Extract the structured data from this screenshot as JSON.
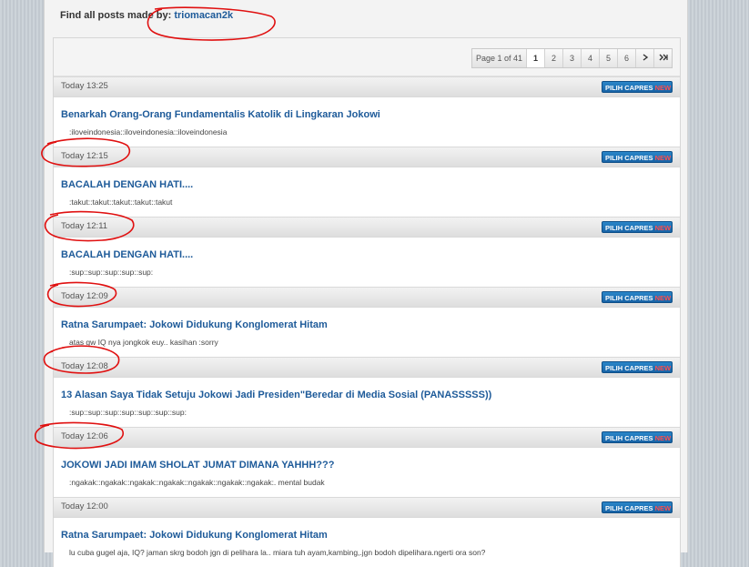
{
  "header": {
    "prefix": "Find all posts made by:",
    "username": "triomacan2k"
  },
  "pager": {
    "info": "Page 1 of 41",
    "pages": [
      "1",
      "2",
      "3",
      "4",
      "5",
      "6"
    ],
    "current": "1",
    "next_icon": "chevron-right-icon",
    "last_icon": "double-chevron-right-icon"
  },
  "badge": {
    "label": "PILIH CAPRES",
    "new": "NEW"
  },
  "colors": {
    "link": "#1d5a99",
    "badge": "#1e6fb5",
    "new": "#ff4e4e",
    "annotation": "#e01010"
  },
  "posts": [
    {
      "time": "Today 13:25",
      "title": "Benarkah Orang-Orang Fundamentalis Katolik di Lingkaran Jokowi",
      "snippet": ":iloveindonesia::iloveindonesia::iloveindonesia"
    },
    {
      "time": "Today 12:15",
      "title": "BACALAH DENGAN HATI....",
      "snippet": ":takut::takut::takut::takut::takut"
    },
    {
      "time": "Today 12:11",
      "title": "BACALAH DENGAN HATI....",
      "snippet": ":sup::sup::sup::sup::sup:"
    },
    {
      "time": "Today 12:09",
      "title": "Ratna Sarumpaet: Jokowi Didukung Konglomerat Hitam",
      "snippet": "atas gw IQ nya jongkok euy.. kasihan :sorry"
    },
    {
      "time": "Today 12:08",
      "title": "13 Alasan Saya Tidak Setuju Jokowi Jadi Presiden\"Beredar di Media Sosial (PANASSSSS))",
      "snippet": ":sup::sup::sup::sup::sup::sup::sup:"
    },
    {
      "time": "Today 12:06",
      "title": "JOKOWI JADI IMAM SHOLAT JUMAT DIMANA YAHHH???",
      "snippet": ":ngakak::ngakak::ngakak::ngakak::ngakak::ngakak::ngakak:. mental budak"
    },
    {
      "time": "Today 12:00",
      "title": "Ratna Sarumpaet: Jokowi Didukung Konglomerat Hitam",
      "snippet": "lu cuba gugel aja, IQ? jaman skrg bodoh jgn di pelihara la.. miara tuh ayam,kambing,.jgn bodoh dipelihara.ngerti ora son?"
    }
  ]
}
